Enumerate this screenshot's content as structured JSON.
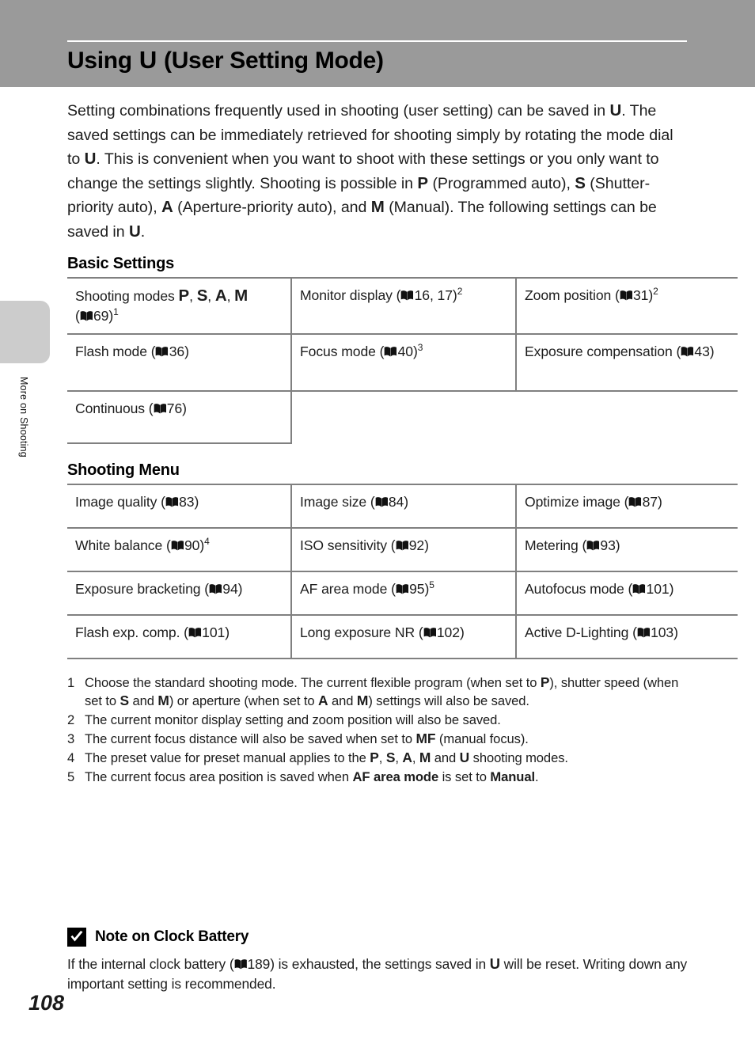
{
  "header": {
    "title_prefix": "Using ",
    "title_glyph": "U",
    "title_suffix": " (User Setting Mode)"
  },
  "sidebar": {
    "tab_label": "More on Shooting"
  },
  "intro": {
    "p1": "Setting combinations frequently used in shooting (user setting) can be saved in ",
    "g1": "U",
    "p2": ". The saved settings can be immediately retrieved for shooting simply by rotating the mode dial to ",
    "g2": "U",
    "p3": ". This is convenient when you want to shoot with these settings or you only want to change the settings slightly. Shooting is possible in ",
    "g3": "P",
    "p4": " (Programmed auto), ",
    "g4": "S",
    "p5": " (Shutter-priority auto), ",
    "g5": "A",
    "p6": " (Aperture-priority auto), and ",
    "g6": "M",
    "p7": " (Manual). The following settings can be saved in ",
    "g7": "U",
    "p8": "."
  },
  "basic_settings": {
    "heading": "Basic Settings",
    "rows": [
      {
        "c1": {
          "pre": "Shooting modes ",
          "modes": [
            "P",
            "S",
            "A",
            "M"
          ],
          "ref_open": " (",
          "ref_page": "69",
          "ref_close": ")",
          "footnote": "1"
        },
        "c2": {
          "pre": "Monitor display (",
          "ref_page": "16, 17",
          "post": ")",
          "footnote": "2"
        },
        "c3": {
          "pre": "Zoom position (",
          "ref_page": "31",
          "post": ")",
          "footnote": "2"
        }
      },
      {
        "c1": {
          "pre": "Flash mode (",
          "ref_page": "36",
          "post": ")",
          "footnote": ""
        },
        "c2": {
          "pre": "Focus mode (",
          "ref_page": "40",
          "post": ")",
          "footnote": "3"
        },
        "c3": {
          "pre": "Exposure compensation (",
          "ref_page": "43",
          "post": ")",
          "footnote": ""
        }
      },
      {
        "c1": {
          "pre": "Continuous (",
          "ref_page": "76",
          "post": ")",
          "footnote": ""
        },
        "c2": null,
        "c3": null
      }
    ]
  },
  "shooting_menu": {
    "heading": "Shooting Menu",
    "rows": [
      [
        {
          "pre": "Image quality (",
          "ref_page": "83",
          "post": ")",
          "footnote": ""
        },
        {
          "pre": "Image size (",
          "ref_page": "84",
          "post": ")",
          "footnote": ""
        },
        {
          "pre": "Optimize image (",
          "ref_page": "87",
          "post": ")",
          "footnote": ""
        }
      ],
      [
        {
          "pre": "White balance (",
          "ref_page": "90",
          "post": ")",
          "footnote": "4"
        },
        {
          "pre": "ISO sensitivity (",
          "ref_page": "92",
          "post": ")",
          "footnote": ""
        },
        {
          "pre": "Metering (",
          "ref_page": "93",
          "post": ")",
          "footnote": ""
        }
      ],
      [
        {
          "pre": "Exposure bracketing (",
          "ref_page": "94",
          "post": ")",
          "footnote": ""
        },
        {
          "pre": "AF area mode (",
          "ref_page": "95",
          "post": ")",
          "footnote": "5"
        },
        {
          "pre": "Autofocus mode (",
          "ref_page": "101",
          "post": ")",
          "footnote": ""
        }
      ],
      [
        {
          "pre": "Flash exp. comp. (",
          "ref_page": "101",
          "post": ")",
          "footnote": ""
        },
        {
          "pre": "Long exposure NR (",
          "ref_page": "102",
          "post": ")",
          "footnote": ""
        },
        {
          "pre": "Active D-Lighting (",
          "ref_page": "103",
          "post": ")",
          "footnote": ""
        }
      ]
    ]
  },
  "footnotes": [
    {
      "num": "1",
      "segments": [
        {
          "t": "Choose the standard shooting mode. The current flexible program (when set to "
        },
        {
          "g": "P"
        },
        {
          "t": "), shutter speed (when set to "
        },
        {
          "g": "S"
        },
        {
          "t": " and "
        },
        {
          "g": "M"
        },
        {
          "t": ") or aperture (when set to "
        },
        {
          "g": "A"
        },
        {
          "t": " and "
        },
        {
          "g": "M"
        },
        {
          "t": ") settings will also be saved."
        }
      ]
    },
    {
      "num": "2",
      "segments": [
        {
          "t": "The current monitor display setting and zoom position will also be saved."
        }
      ]
    },
    {
      "num": "3",
      "segments": [
        {
          "t": "The current focus distance will also be saved when set to "
        },
        {
          "g": "MF"
        },
        {
          "t": " (manual focus)."
        }
      ]
    },
    {
      "num": "4",
      "segments": [
        {
          "t": "The preset value for preset manual applies to the "
        },
        {
          "g": "P"
        },
        {
          "t": ", "
        },
        {
          "g": "S"
        },
        {
          "t": ", "
        },
        {
          "g": "A"
        },
        {
          "t": ", "
        },
        {
          "g": "M"
        },
        {
          "t": " and "
        },
        {
          "g": "U"
        },
        {
          "t": " shooting modes."
        }
      ]
    },
    {
      "num": "5",
      "segments": [
        {
          "t": "The current focus area position is saved when "
        },
        {
          "b": "AF area mode"
        },
        {
          "t": " is set to "
        },
        {
          "b": "Manual"
        },
        {
          "t": "."
        }
      ]
    }
  ],
  "note": {
    "icon": "checkmark-box-icon",
    "title": "Note on Clock Battery",
    "body_pre": "If the internal clock battery (",
    "body_ref_page": "189",
    "body_mid": ") is exhausted, the settings saved in ",
    "body_glyph": "U",
    "body_post": " will be reset. Writing down any important setting is recommended."
  },
  "page_number": "108",
  "colors": {
    "header_band": "#9a9a9a",
    "table_border": "#808080",
    "side_tab": "#cccccc",
    "text": "#1d1d1d"
  }
}
